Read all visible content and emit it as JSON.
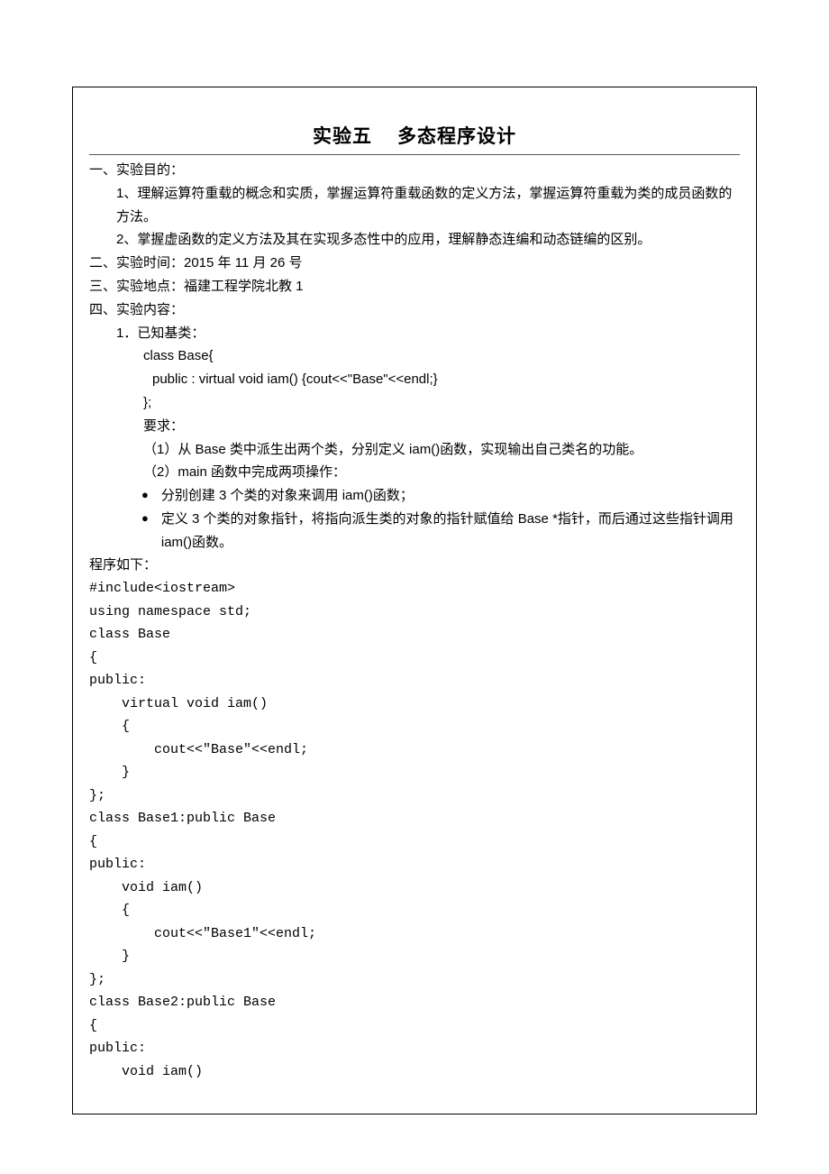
{
  "title_left": "实验五",
  "title_right": "多态程序设计",
  "section1_heading": "一、实验目的：",
  "section1_item1": "1、理解运算符重载的概念和实质，掌握运算符重载函数的定义方法，掌握运算符重载为类的成员函数的方法。",
  "section1_item2": "2、掌握虚函数的定义方法及其在实现多态性中的应用，理解静态连编和动态链编的区别。",
  "section2_line": "二、实验时间：2015 年 11 月 26 号",
  "section3_line": "三、实验地点：福建工程学院北教 1",
  "section4_heading": "四、实验内容：",
  "section4_item1": "1．已知基类：",
  "base_class_1": "class Base{",
  "base_class_2": "public : virtual void   iam() {cout<<\"Base\"<<endl;}",
  "base_class_3": "};",
  "req_label": "要求：",
  "req_1": "（1）从 Base 类中派生出两个类，分别定义 iam()函数，实现输出自己类名的功能。",
  "req_2": "（2）main 函数中完成两项操作：",
  "bullet_1": "分别创建 3 个类的对象来调用 iam()函数；",
  "bullet_2": "定义 3 个类的对象指针，将指向派生类的对象的指针赋值给 Base *指针，而后通过这些指针调用 iam()函数。",
  "program_label": "程序如下：",
  "code_lines": [
    "#include<iostream>",
    "using namespace std;",
    "class Base",
    "{",
    "public:",
    "    virtual void iam()",
    "    {",
    "        cout<<\"Base\"<<endl;",
    "    }",
    "};",
    "class Base1:public Base",
    "{",
    "public:",
    "    void iam()",
    "    {",
    "        cout<<\"Base1\"<<endl;",
    "    }",
    "};",
    "class Base2:public Base",
    "{",
    "public:",
    "    void iam()"
  ]
}
